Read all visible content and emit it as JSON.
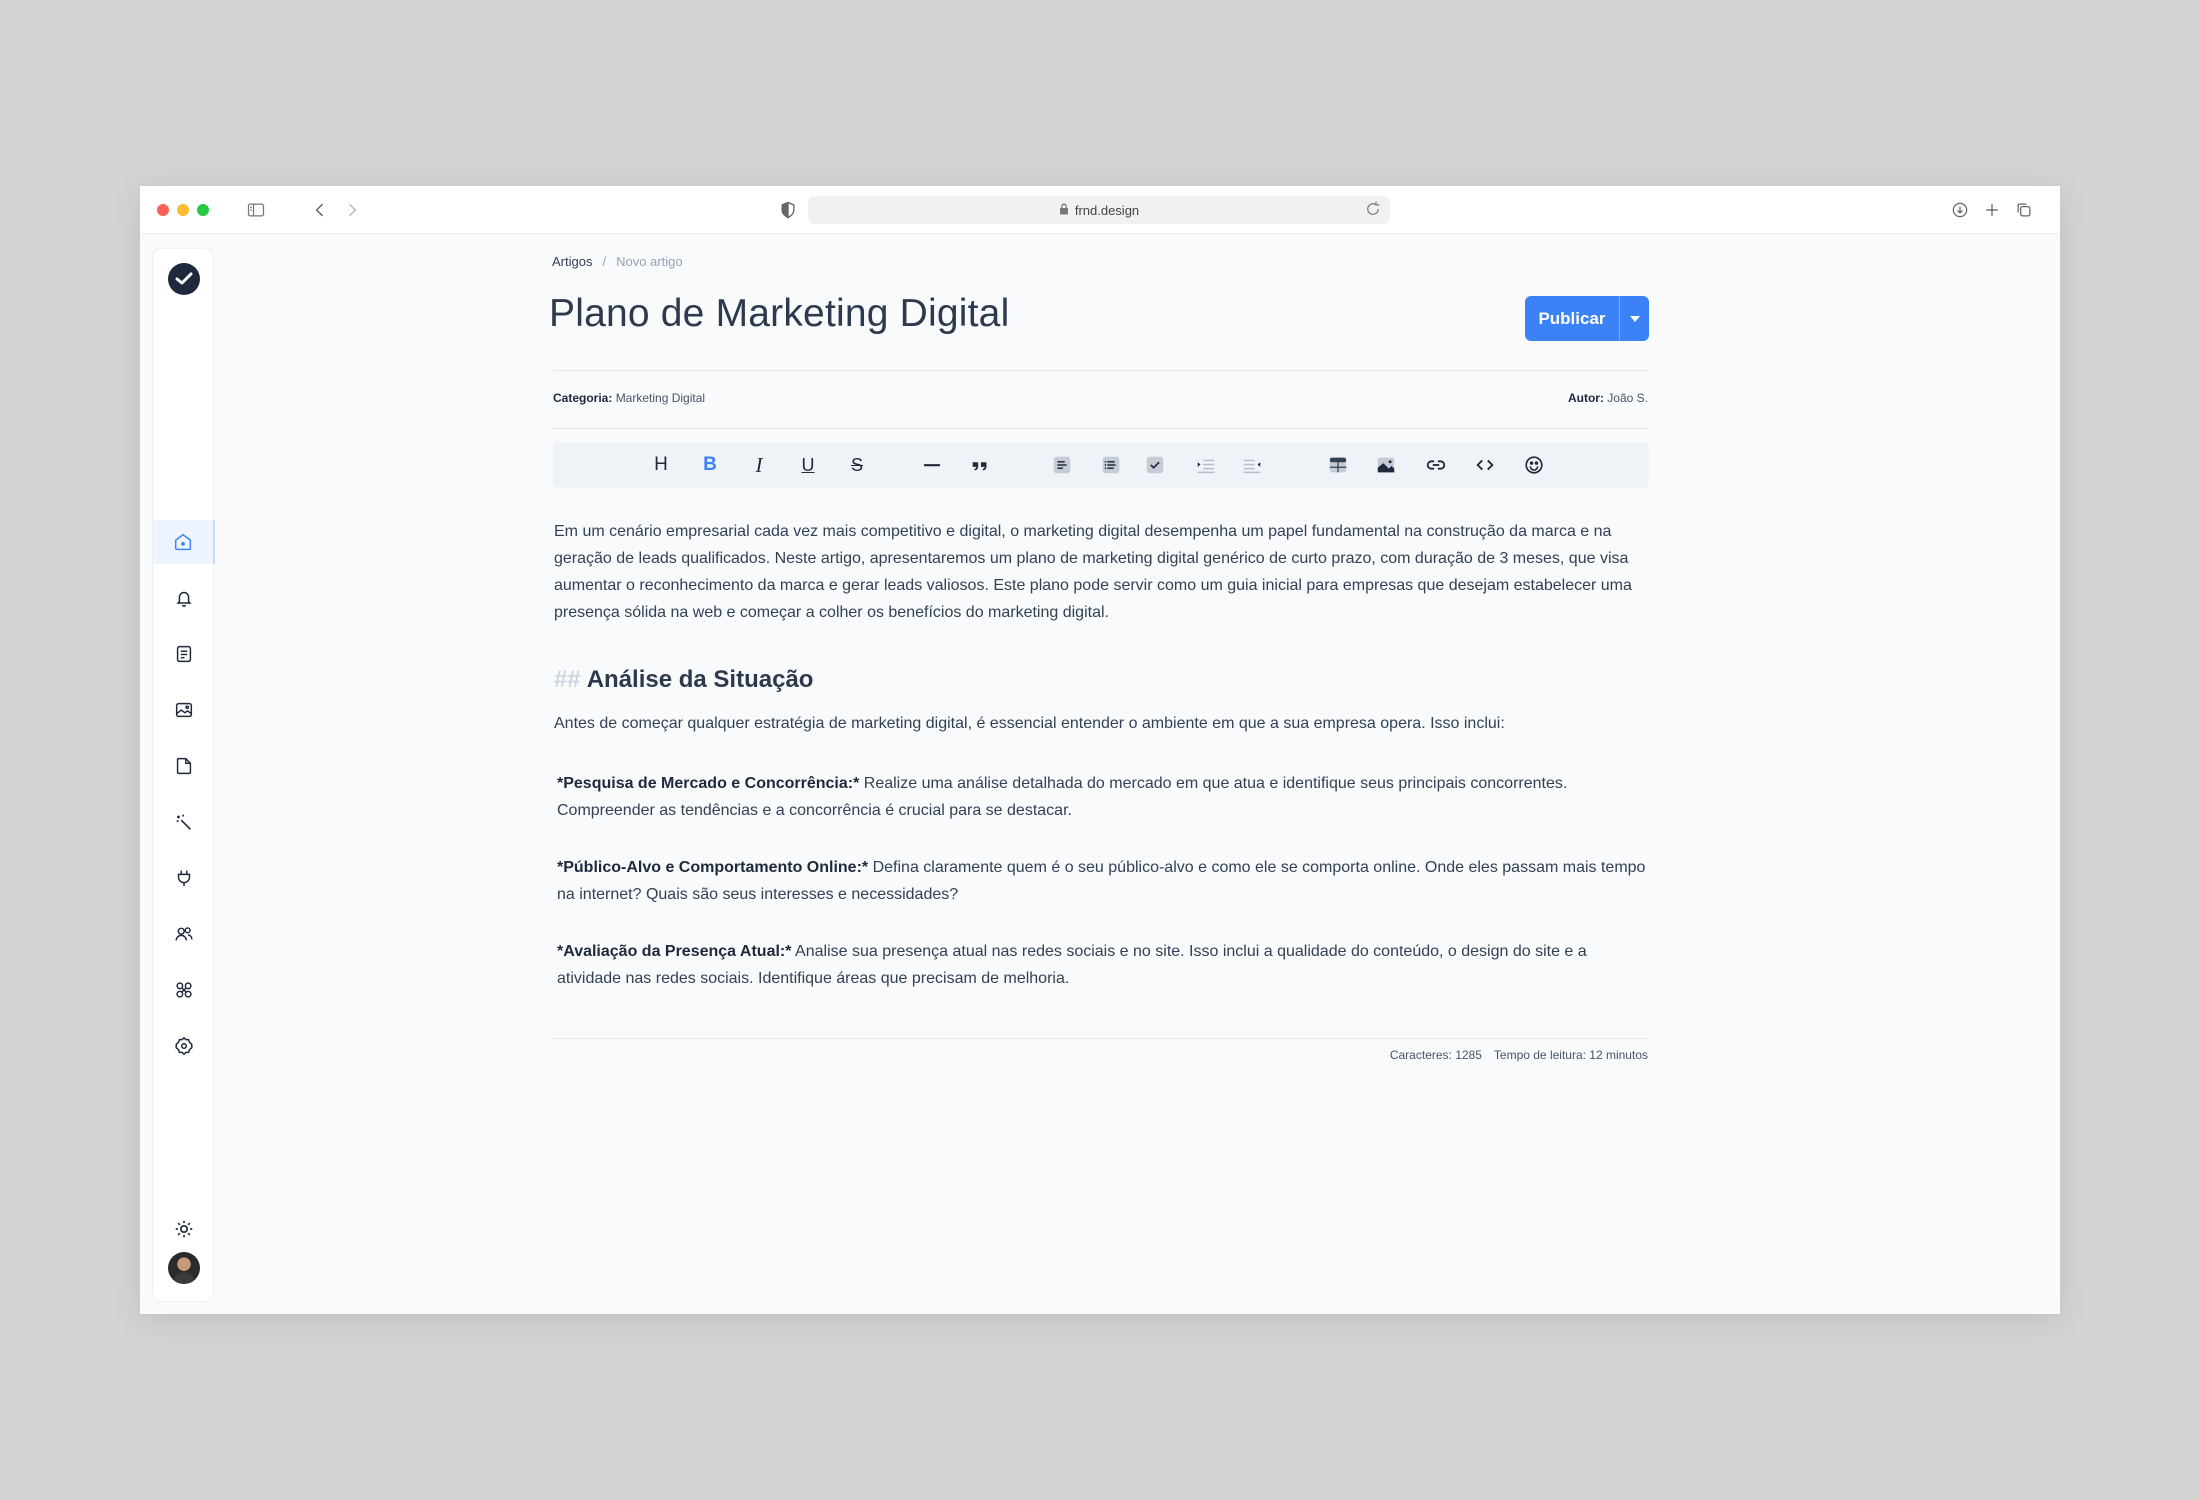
{
  "browser": {
    "url": "frnd.design"
  },
  "breadcrumb": {
    "parent": "Artigos",
    "separator": "/",
    "current": "Novo artigo"
  },
  "page": {
    "title": "Plano de Marketing Digital"
  },
  "publish": {
    "label": "Publicar"
  },
  "meta": {
    "category_label": "Categoria:",
    "category_value": "Marketing Digital",
    "author_label": "Autor:",
    "author_value": "João S."
  },
  "toolbar": {
    "heading": "H",
    "bold": "B",
    "italic": "I",
    "underline": "U",
    "strike": "S",
    "active_color": "#3b82f6"
  },
  "article": {
    "intro": "Em um cenário empresarial cada vez mais competitivo e digital, o marketing digital desempenha um papel fundamental na construção da marca e na geração de leads qualificados. Neste artigo, apresentaremos um plano de marketing digital genérico de curto prazo, com duração de 3 meses, que visa aumentar o reconhecimento da marca e gerar leads valiosos. Este plano pode servir como um guia inicial para empresas que desejam estabelecer uma presença sólida na web e começar a colher os benefícios do marketing digital.",
    "heading_marker": "##",
    "heading": "Análise da Situação",
    "lead": "Antes de começar qualquer estratégia de marketing digital, é essencial entender o ambiente em que a sua empresa opera. Isso inclui:",
    "items": [
      {
        "title": "*Pesquisa de Mercado e Concorrência:*",
        "text": " Realize uma análise detalhada do mercado em que atua e identifique seus principais concorrentes. Compreender as tendências e a concorrência é crucial para se destacar."
      },
      {
        "title": "*Público-Alvo e Comportamento Online:*",
        "text": " Defina claramente quem é o seu público-alvo e como ele se comporta online. Onde eles passam mais tempo na internet? Quais são seus interesses e necessidades?"
      },
      {
        "title": "*Avaliação da Presença Atual:*",
        "text": " Analise sua presença atual nas redes sociais e no site. Isso inclui a qualidade do conteúdo, o design do site e a atividade nas redes sociais. Identifique áreas que precisam de melhoria."
      }
    ]
  },
  "status": {
    "characters": "Caracteres: 1285",
    "reading_time": "Tempo de leitura: 12 minutos"
  },
  "sidebar": {
    "items": [
      "home-icon",
      "bell-icon",
      "document-icon",
      "image-icon",
      "file-icon",
      "magic-wand-icon",
      "plug-icon",
      "users-icon",
      "integrations-icon",
      "settings-icon"
    ],
    "active_color": "#3b82f6"
  }
}
